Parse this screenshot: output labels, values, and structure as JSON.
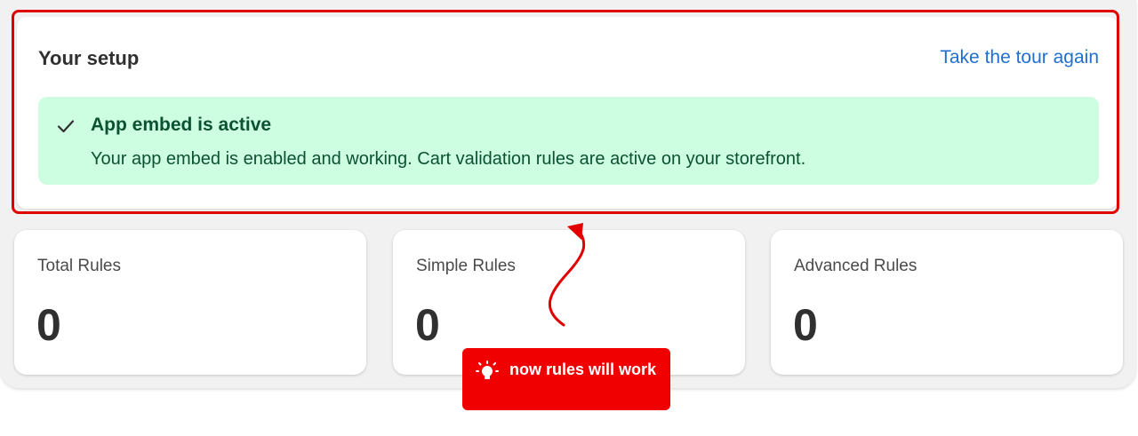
{
  "setup": {
    "title": "Your setup",
    "tour_link": "Take the tour again",
    "banner": {
      "icon": "checkmark-icon",
      "title": "App embed is active",
      "message": "Your app embed is enabled and working. Cart validation rules are active on your storefront."
    }
  },
  "stats": [
    {
      "label": "Total Rules",
      "value": "0"
    },
    {
      "label": "Simple Rules",
      "value": "0"
    },
    {
      "label": "Advanced Rules",
      "value": "0"
    }
  ],
  "annotation": {
    "icon": "lightbulb-icon",
    "text": "now rules will work"
  },
  "colors": {
    "highlight": "#e00000",
    "link": "#1f6fd1",
    "success_bg": "#cdfee1",
    "success_text": "#0c5132",
    "callout_bg": "#f00000"
  }
}
